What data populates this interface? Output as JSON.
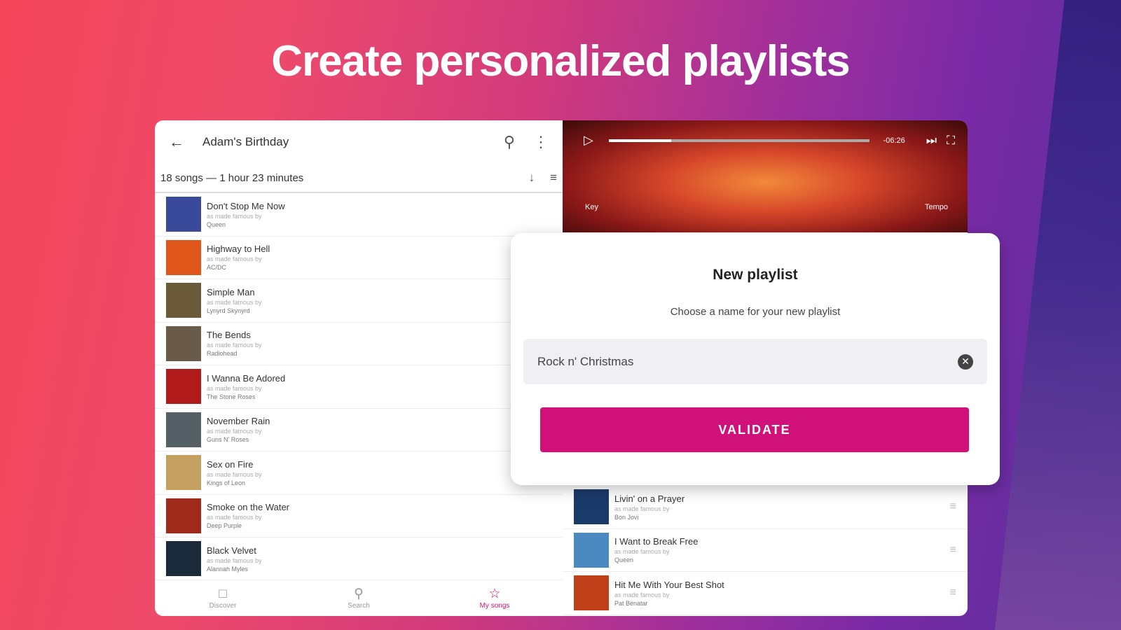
{
  "headline": "Create personalized playlists",
  "playlist": {
    "title": "Adam's Birthday",
    "summary": "18 songs — 1 hour 23 minutes",
    "icons": [
      "back-arrow-icon",
      "search-icon",
      "more-vert-icon",
      "download-icon",
      "sort-icon"
    ]
  },
  "songs": [
    {
      "title": "Don't Stop Me Now",
      "subtitle": "as made famous by",
      "artist": "Queen",
      "color": "#3a4a9a"
    },
    {
      "title": "Highway to Hell",
      "subtitle": "as made famous by",
      "artist": "AC/DC",
      "color": "#e0551a"
    },
    {
      "title": "Simple Man",
      "subtitle": "as made famous by",
      "artist": "Lynyrd Skynyrd",
      "color": "#6a5a3a"
    },
    {
      "title": "The Bends",
      "subtitle": "as made famous by",
      "artist": "Radiohead",
      "color": "#6a5a4a"
    },
    {
      "title": "I Wanna Be Adored",
      "subtitle": "as made famous by",
      "artist": "The Stone Roses",
      "color": "#b01a1a"
    },
    {
      "title": "November Rain",
      "subtitle": "as made famous by",
      "artist": "Guns N' Roses",
      "color": "#556066"
    },
    {
      "title": "Sex on Fire",
      "subtitle": "as made famous by",
      "artist": "Kings of Leon",
      "color": "#c4a060"
    },
    {
      "title": "Smoke on the Water",
      "subtitle": "as made famous by",
      "artist": "Deep Purple",
      "color": "#a02a1a"
    },
    {
      "title": "Black Velvet",
      "subtitle": "as made famous by",
      "artist": "Alannah Myles",
      "color": "#1a2a3a"
    }
  ],
  "right_songs": [
    {
      "title": "Livin' on a Prayer",
      "subtitle": "as made famous by",
      "artist": "Bon Jovi",
      "color": "#1a3a6a"
    },
    {
      "title": "I Want to Break Free",
      "subtitle": "as made famous by",
      "artist": "Queen",
      "color": "#4a8ac0"
    },
    {
      "title": "Hit Me With Your Best Shot",
      "subtitle": "as made famous by",
      "artist": "Pat Benatar",
      "color": "#c0401a"
    }
  ],
  "player": {
    "time": "-06:26",
    "progress": 0.24,
    "key_label": "Key",
    "tempo_label": "Tempo"
  },
  "nav": [
    {
      "label": "Discover",
      "icon": "book-icon",
      "active": false
    },
    {
      "label": "Search",
      "icon": "search-icon",
      "active": false
    },
    {
      "label": "My songs",
      "icon": "star-icon",
      "active": true
    }
  ],
  "dialog": {
    "title": "New playlist",
    "subtitle": "Choose a name for your new playlist",
    "input_value": "Rock n' Christmas",
    "button": "VALIDATE"
  },
  "colors": {
    "accent": "#d1117a"
  }
}
